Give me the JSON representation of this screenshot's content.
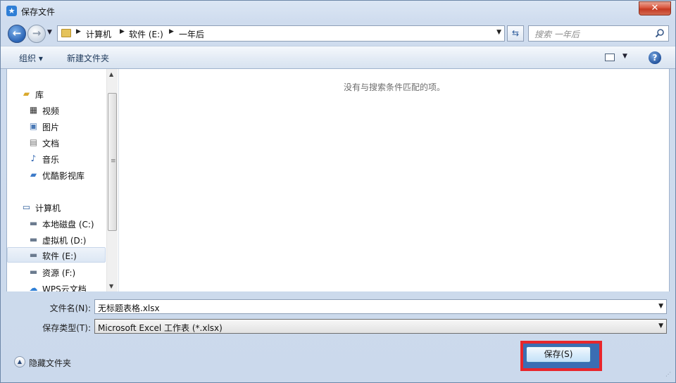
{
  "window": {
    "title": "保存文件"
  },
  "nav": {
    "breadcrumbs": [
      "计算机",
      "软件 (E:)",
      "一年后"
    ],
    "search_placeholder": "搜索 一年后"
  },
  "toolbar": {
    "organize_label": "组织 ▾",
    "new_folder_label": "新建文件夹"
  },
  "sidebar": {
    "items": [
      {
        "label": "库",
        "icon": "library-icon",
        "level": 0
      },
      {
        "label": "视频",
        "icon": "video-icon",
        "level": 1
      },
      {
        "label": "图片",
        "icon": "picture-icon",
        "level": 1
      },
      {
        "label": "文档",
        "icon": "document-icon",
        "level": 1
      },
      {
        "label": "音乐",
        "icon": "music-icon",
        "level": 1
      },
      {
        "label": "优酷影视库",
        "icon": "youku-library-icon",
        "level": 1
      },
      {
        "label": "计算机",
        "icon": "computer-icon",
        "level": 0
      },
      {
        "label": "本地磁盘 (C:)",
        "icon": "system-drive-icon",
        "level": 1
      },
      {
        "label": "虚拟机 (D:)",
        "icon": "drive-icon",
        "level": 1
      },
      {
        "label": "软件 (E:)",
        "icon": "drive-icon",
        "level": 1,
        "selected": true
      },
      {
        "label": "资源 (F:)",
        "icon": "drive-icon",
        "level": 1
      },
      {
        "label": "WPS云文档",
        "icon": "wps-cloud-icon",
        "level": 1
      }
    ]
  },
  "main": {
    "empty_message": "没有与搜索条件匹配的项。"
  },
  "form": {
    "filename_label": "文件名(N):",
    "filename_value": "无标题表格.xlsx",
    "filetype_label": "保存类型(T):",
    "filetype_value": "Microsoft Excel 工作表 (*.xlsx)"
  },
  "footer": {
    "hide_folders_label": "隐藏文件夹",
    "save_label": "保存(S)"
  },
  "colors": {
    "highlight_border": "#e8262b",
    "close_button": "#c43a23"
  }
}
